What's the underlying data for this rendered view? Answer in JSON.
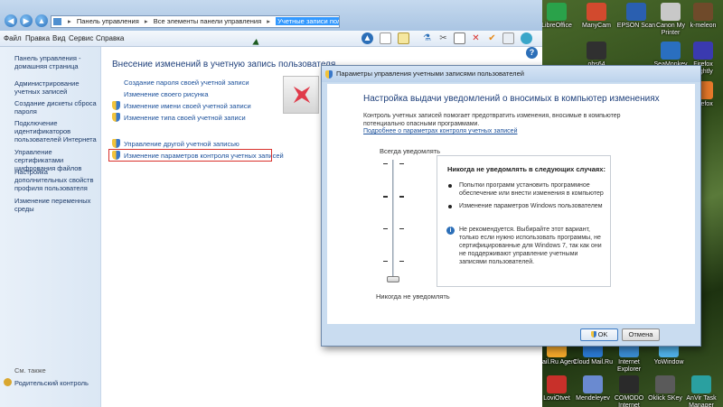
{
  "address": {
    "crumbs": [
      "Панель управления",
      "Все элементы панели управления"
    ],
    "current": "Учетные записи пользователей"
  },
  "menu": [
    "Файл",
    "Правка",
    "Вид",
    "Сервис",
    "Справка"
  ],
  "left_pane": {
    "links": [
      "Панель управления - домашняя страница",
      "Администрирование учетных записей",
      "Создание дискеты сброса пароля",
      "Подключение идентификаторов пользователей Интернета",
      "Управление сертификатами шифрования файлов",
      "Настройка дополнительных свойств профиля пользователя",
      "Изменение переменных среды"
    ],
    "see_also": "См. также",
    "parental": "Родительский контроль"
  },
  "main": {
    "heading": "Внесение изменений в учетную запись пользователя",
    "links": [
      "Создание пароля своей учетной записи",
      "Изменение своего рисунка",
      "Изменение имени своей учетной записи",
      "Изменение типа своей учетной записи",
      "Управление другой учетной записью",
      "Изменение параметров контроля учетных записей"
    ]
  },
  "uac": {
    "title": "Параметры управления учетными записями пользователей",
    "heading": "Настройка выдачи уведомлений о вносимых в компьютер изменениях",
    "description": "Контроль учетных записей помогает предотвратить изменения, вносимые в компьютер потенциально опасными программами.",
    "link": "Подробнее о параметрах контроля учетных записей",
    "always_label": "Всегда уведомлять",
    "never_label": "Никогда не уведомлять",
    "slider_level": 0,
    "info_title": "Никогда не уведомлять в следующих случаях:",
    "bullets": [
      "Попытки программ установить программное обеспечение или внести изменения в компьютер",
      "Изменение параметров Windows пользователем"
    ],
    "warning": "Не рекомендуется. Выбирайте этот вариант, только если нужно использовать программы, не сертифицированные для Windows 7, так как они не поддерживают управление учетными записями пользователей.",
    "ok": "OK",
    "cancel": "Отмена"
  },
  "desktop_icons": [
    "LibreOffice",
    "ManyCam",
    "EPSON Scan",
    "Canon My Printer",
    "k-meleon",
    "obs64",
    "SeaMonkey",
    "Firefox Nightly",
    "Firefox",
    "Mail.Ru Agent",
    "Cloud Mail.Ru",
    "Internet Explorer",
    "YoWindow",
    "LoviOtvet",
    "Mendeleyev",
    "COMODO Internet",
    "Oklick SKey",
    "AnVir Task Manager"
  ]
}
